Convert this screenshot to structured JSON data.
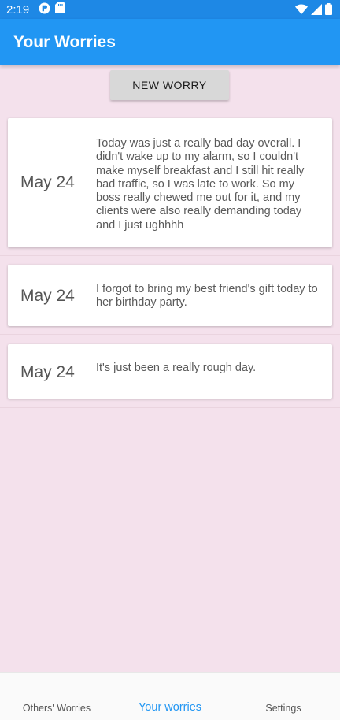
{
  "status_bar": {
    "time": "2:19"
  },
  "app_bar": {
    "title": "Your Worries"
  },
  "actions": {
    "new_worry_label": "NEW WORRY"
  },
  "worries": [
    {
      "date": "May 24",
      "text": "Today was just a really bad day overall. I didn't wake up to my alarm, so I couldn't make myself breakfast and I still hit really bad traffic, so I was late to work. So my boss really chewed me out for it, and my clients were also really demanding today and I just ughhhh"
    },
    {
      "date": "May 24",
      "text": "I forgot to bring my best friend's gift today to her birthday party."
    },
    {
      "date": "May 24",
      "text": "It's just been a really rough day."
    }
  ],
  "bottom_nav": {
    "items": [
      {
        "label": "Others' Worries",
        "active": false
      },
      {
        "label": "Your worries",
        "active": true
      },
      {
        "label": "Settings",
        "active": false
      }
    ]
  },
  "colors": {
    "primary": "#2196f3",
    "status_bar": "#1e88e5",
    "background": "#f4e1ec"
  }
}
